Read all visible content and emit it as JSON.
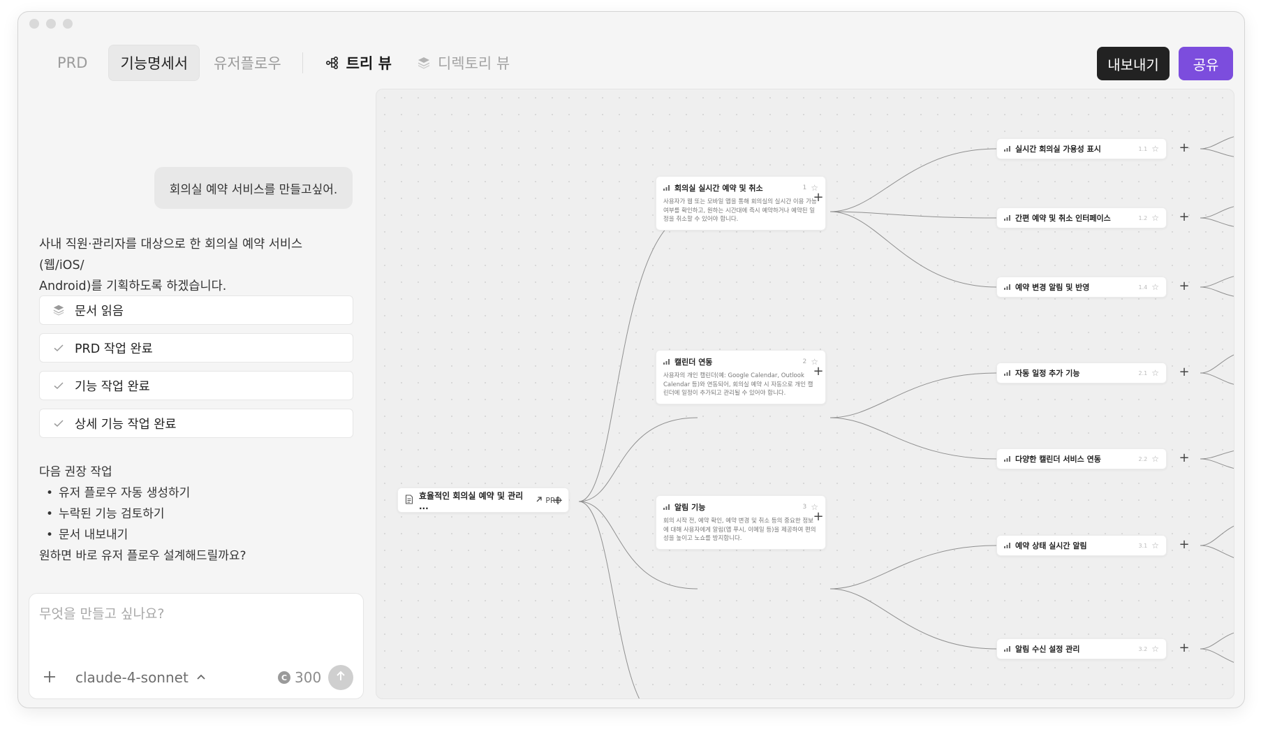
{
  "tabs": {
    "prd": "PRD",
    "features": "기능명세서",
    "userflow": "유저플로우",
    "tree_view": "트리 뷰",
    "directory_view": "디렉토리 뷰"
  },
  "actions": {
    "export": "내보내기",
    "share": "공유"
  },
  "chat": {
    "user_message": "회의실 예약 서비스를 만들고싶어.",
    "assistant_line1": "사내 직원·관리자를 대상으로 한 회의실 예약 서비스(웹/iOS/",
    "assistant_line2": "Android)를 기획하도록 하겠습니다.",
    "steps": [
      {
        "label": "문서 읽음",
        "icon": "layers-icon"
      },
      {
        "label": "PRD 작업 완료",
        "icon": "check-icon"
      },
      {
        "label": "기능 작업 완료",
        "icon": "check-icon"
      },
      {
        "label": "상세 기능 작업 완료",
        "icon": "check-icon"
      }
    ],
    "next_title": "다음 권장 작업",
    "next_items": [
      "유저 플로우 자동 생성하기",
      "누락된 기능 검토하기",
      "문서 내보내기"
    ],
    "closing": "원하면 바로 유저 플로우 설계해드릴까요?"
  },
  "composer": {
    "placeholder": "무엇을 만들고 싶나요?",
    "model": "claude-4-sonnet",
    "credits": "300",
    "coin_letter": "C"
  },
  "tree": {
    "root": {
      "title": "효율적인 회의실 예약 및 관리 ...",
      "tag": "PRD"
    },
    "features": [
      {
        "title": "회의실 실시간 예약 및 취소",
        "num": "1",
        "desc": "사용자가 웹 또는 모바일 앱을 통해 회의실의 실시간 이용 가능 여부를 확인하고, 원하는 시간대에 즉시 예약하거나 예약된 일정을 취소할 수 있어야 합니다.",
        "children": [
          {
            "title": "실시간 회의실 가용성 표시",
            "num": "1.1"
          },
          {
            "title": "간편 예약 및 취소 인터페이스",
            "num": "1.2"
          },
          {
            "title": "예약 변경 알림 및 반영",
            "num": "1.4"
          }
        ]
      },
      {
        "title": "캘린더 연동",
        "num": "2",
        "desc": "사용자의 개인 캘린더(예: Google Calendar, Outlook Calendar 등)와 연동되어, 회의실 예약 시 자동으로 개인 캘린더에 일정이 추가되고 관리될 수 있어야 합니다.",
        "children": [
          {
            "title": "자동 일정 추가 기능",
            "num": "2.1"
          },
          {
            "title": "다양한 캘린더 서비스 연동",
            "num": "2.2"
          }
        ]
      },
      {
        "title": "알림 기능",
        "num": "3",
        "desc": "회의 시작 전, 예약 확인, 예약 변경 및 취소 등의 중요한 정보에 대해 사용자에게 알림(앱 푸시, 이메일 등)을 제공하여 편의성을 높이고 노쇼를 방지합니다.",
        "children": [
          {
            "title": "예약 상태 실시간 알림",
            "num": "3.1"
          },
          {
            "title": "알림 수신 설정 관리",
            "num": "3.2"
          }
        ]
      }
    ]
  }
}
